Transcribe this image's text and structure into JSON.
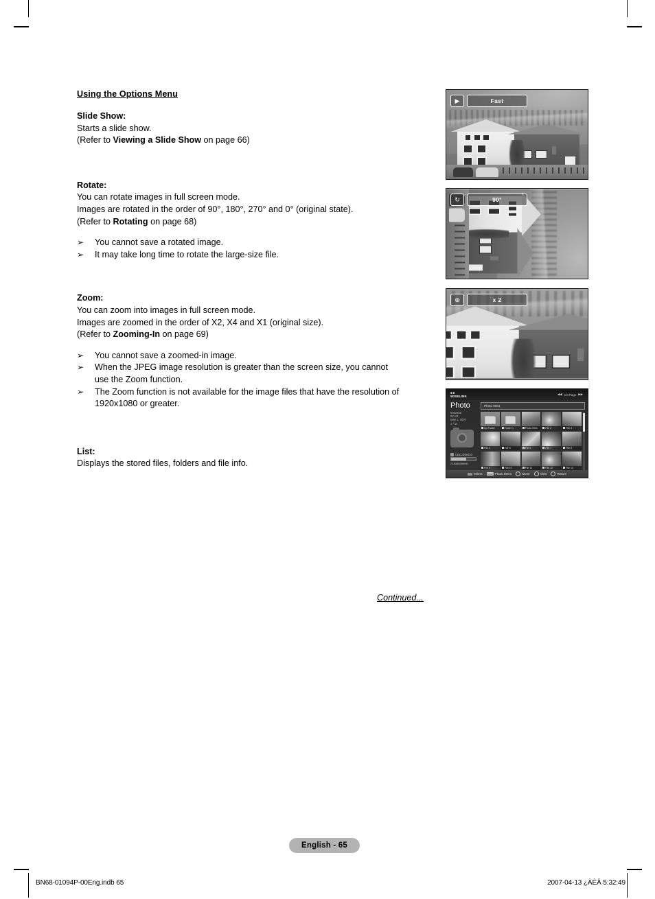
{
  "section": {
    "title": "Using the Options Menu"
  },
  "blocks": [
    {
      "label": "Slide Show:",
      "lines": [
        {
          "text": "Starts a slide show."
        },
        {
          "pre": "(Refer to ",
          "bold": "Viewing a Slide Show",
          "post": " on page 66)"
        }
      ],
      "notes": []
    },
    {
      "label": "Rotate:",
      "lines": [
        {
          "text": "You can rotate images in full screen mode."
        },
        {
          "text": "Images are rotated in the order of 90°, 180°, 270° and 0° (original state)."
        },
        {
          "pre": "(Refer to ",
          "bold": "Rotating",
          "post": " on page 68)"
        }
      ],
      "notes": [
        {
          "text": "You cannot save a rotated image."
        },
        {
          "text": "It may take long time to rotate the large-size file."
        }
      ]
    },
    {
      "label": "Zoom:",
      "lines": [
        {
          "text": "You can zoom into images in full screen mode."
        },
        {
          "text": "Images are zoomed in the order of X2, X4 and X1 (original size)."
        },
        {
          "pre": "(Refer to ",
          "bold": "Zooming-In",
          "post": " on page 69)"
        }
      ],
      "notes": [
        {
          "text": "You cannot save a zoomed-in image."
        },
        {
          "text": "When the JPEG image resolution is greater than the screen size, you cannot",
          "cont": "use the Zoom function."
        },
        {
          "text": "The Zoom function is not available for the image files that have the resolution of",
          "cont": "1920x1080 or greater."
        }
      ]
    },
    {
      "label": "List:",
      "lines": [
        {
          "text": "Displays the stored files, folders and file info."
        }
      ],
      "notes": []
    }
  ],
  "continued": "Continued...",
  "bullet_glyph": "➢",
  "figures": {
    "slideshow": {
      "osd_icon": "slideshow-icon",
      "osd_icon_glyph": "▶",
      "osd_label": "Fast"
    },
    "rotate": {
      "osd_icon": "rotate-icon",
      "osd_icon_glyph": "↻",
      "osd_label": "90°"
    },
    "zoom": {
      "osd_icon": "magnifier-plus-icon",
      "osd_icon_glyph": "⊕",
      "osd_label": "x 2"
    },
    "list": {
      "logo_top": "■■",
      "logo": "WISELINK",
      "page_prev": "◀◀",
      "page_indicator": "1/3 Page",
      "page_next": "▶▶",
      "panel_title": "Photo",
      "meta": [
        "640x640",
        "52 KB",
        "May 1, 2007",
        "1 / 14"
      ],
      "device": "CELLDISK10",
      "capacity": "213MB/256MB",
      "breadcrumb": "Photo 0001",
      "items": [
        {
          "name": "Up Folder",
          "kind": "folder"
        },
        {
          "name": "Folder 1",
          "kind": "folder"
        },
        {
          "name": "Photo 0001",
          "kind": "photo",
          "selected": true
        },
        {
          "name": "File 2",
          "kind": "photo"
        },
        {
          "name": "File 3",
          "kind": "photo"
        },
        {
          "name": "File 4",
          "kind": "photo"
        },
        {
          "name": "File 5",
          "kind": "photo"
        },
        {
          "name": "File 6",
          "kind": "photo"
        },
        {
          "name": "File 7",
          "kind": "photo"
        },
        {
          "name": "File 8",
          "kind": "photo"
        },
        {
          "name": "File 9",
          "kind": "photo"
        },
        {
          "name": "File 10",
          "kind": "photo"
        },
        {
          "name": "File 11",
          "kind": "photo"
        },
        {
          "name": "File 12",
          "kind": "photo"
        },
        {
          "name": "File 13",
          "kind": "photo"
        }
      ],
      "keys": [
        {
          "icon": "color-button",
          "label": "Select"
        },
        {
          "icon": "tools-button",
          "label": "Photo Menu"
        },
        {
          "icon": "arrows-button",
          "label": "Move"
        },
        {
          "icon": "enter-button",
          "label": "View"
        },
        {
          "icon": "return-button",
          "label": "Return"
        }
      ]
    }
  },
  "page_badge": "English - 65",
  "footer": {
    "left": "BN68-01094P-00Eng.indb   65",
    "right": "2007-04-13   ¿ÀÈÄ 5:32:49"
  }
}
